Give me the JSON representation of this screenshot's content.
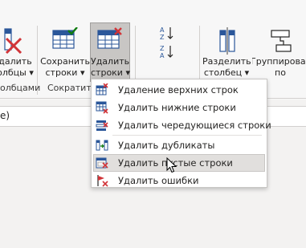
{
  "ribbon": {
    "remove_columns": {
      "label1": "далить",
      "label2": "олбцы ▾"
    },
    "keep_rows": {
      "label1": "Сохранить",
      "label2": "строки ▾"
    },
    "remove_rows": {
      "label1": "Удалить",
      "label2": "строки ▾"
    },
    "split_column": {
      "label1": "Разделить",
      "label2": "столбец ▾"
    },
    "group_by": {
      "label1": "Группировать",
      "label2": "по"
    },
    "groups": {
      "columns": "олбцами",
      "reduce": "Сократить"
    }
  },
  "formula_bar": {
    "text": "e)"
  },
  "remove_rows_menu": {
    "items": [
      {
        "label": "Удаление верхних строк",
        "icon": "remove-top-rows-icon"
      },
      {
        "label": "Удалить нижние строки",
        "icon": "remove-bottom-rows-icon"
      },
      {
        "label": "Удалить чередующиеся строки",
        "icon": "remove-alternate-rows-icon"
      },
      {
        "label": "Удалить дубликаты",
        "icon": "remove-duplicates-icon"
      },
      {
        "label": "Удалить пустые строки",
        "icon": "remove-blank-rows-icon"
      },
      {
        "label": "Удалить ошибки",
        "icon": "remove-errors-icon"
      }
    ],
    "hovered_index": 4
  },
  "colors": {
    "accent_red": "#d13438",
    "accent_green": "#107c10",
    "table_blue": "#2b579a",
    "hover_bg": "#e1dfdd"
  }
}
